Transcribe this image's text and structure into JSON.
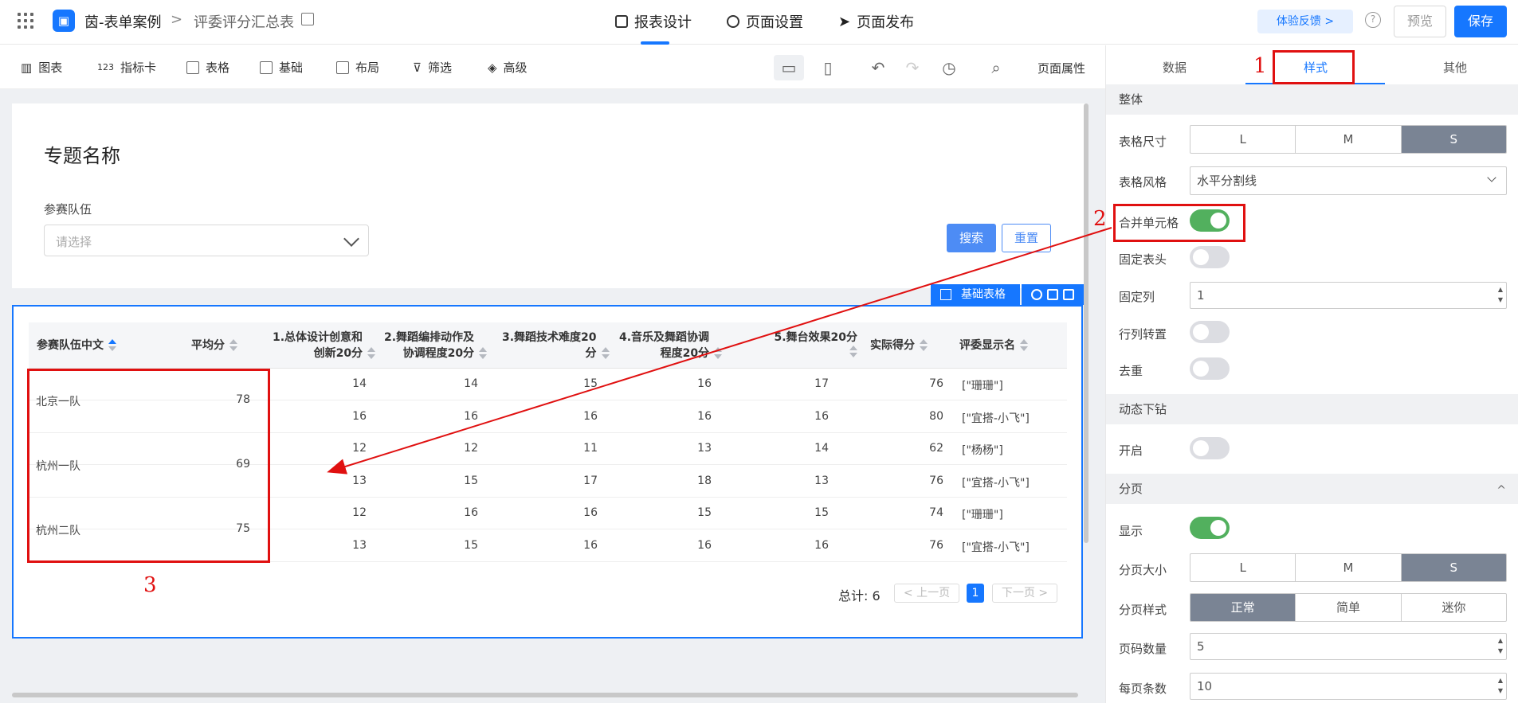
{
  "app": {
    "title": "茵-表单案例",
    "breadcrumb": "评委评分汇总表"
  },
  "top_tabs": [
    "报表设计",
    "页面设置",
    "页面发布"
  ],
  "feedback": "体验反馈 >",
  "help": "?",
  "preview": "预览",
  "save": "保存",
  "toolbar": {
    "items": [
      "图表",
      "指标卡",
      "表格",
      "基础",
      "布局",
      "筛选",
      "高级"
    ],
    "card_prefix": "123",
    "page_props": "页面属性"
  },
  "canvas": {
    "title": "专题名称",
    "filter_label": "参赛队伍",
    "filter_placeholder": "请选择",
    "search_btn": "搜索",
    "reset_btn": "重置",
    "table_tag": "基础表格"
  },
  "table": {
    "headers": [
      {
        "l1": "参赛队伍中文",
        "l2": ""
      },
      {
        "l1": "平均分",
        "l2": ""
      },
      {
        "l1": "1.总体设计创意和",
        "l2": "创新20分"
      },
      {
        "l1": "2.舞蹈编排动作及",
        "l2": "协调程度20分"
      },
      {
        "l1": "3.舞蹈技术难度20",
        "l2": "分"
      },
      {
        "l1": "4.音乐及舞蹈协调",
        "l2": "程度20分"
      },
      {
        "l1": "5.舞台效果20分",
        "l2": ""
      },
      {
        "l1": "实际得分",
        "l2": ""
      },
      {
        "l1": "评委显示名",
        "l2": ""
      }
    ],
    "merged": [
      {
        "team": "北京一队",
        "avg": "78"
      },
      {
        "team": "杭州一队",
        "avg": "69"
      },
      {
        "team": "杭州二队",
        "avg": "75"
      }
    ],
    "rows": [
      [
        "14",
        "14",
        "15",
        "16",
        "17",
        "76",
        "[\"珊珊\"]"
      ],
      [
        "16",
        "16",
        "16",
        "16",
        "16",
        "80",
        "[\"宜搭-小飞\"]"
      ],
      [
        "12",
        "12",
        "11",
        "13",
        "14",
        "62",
        "[\"杨杨\"]"
      ],
      [
        "13",
        "15",
        "17",
        "18",
        "13",
        "76",
        "[\"宜搭-小飞\"]"
      ],
      [
        "12",
        "16",
        "16",
        "15",
        "15",
        "74",
        "[\"珊珊\"]"
      ],
      [
        "13",
        "15",
        "16",
        "16",
        "16",
        "76",
        "[\"宜搭-小飞\"]"
      ]
    ],
    "pager": {
      "total": "总计: 6",
      "prev": "上一页",
      "page": "1",
      "next": "下一页"
    }
  },
  "panel": {
    "tabs": [
      "数据",
      "样式",
      "其他"
    ],
    "sec_overall": "整体",
    "table_size_label": "表格尺寸",
    "sizes": [
      "L",
      "M",
      "S"
    ],
    "table_style_label": "表格风格",
    "table_style_value": "水平分割线",
    "merge_label": "合并单元格",
    "fix_header_label": "固定表头",
    "fix_col_label": "固定列",
    "fix_col_value": "1",
    "transpose_label": "行列转置",
    "dedupe_label": "去重",
    "sec_drill": "动态下钻",
    "drill_on_label": "开启",
    "sec_paging": "分页",
    "paging_collapse": "^",
    "show_label": "显示",
    "page_size_label": "分页大小",
    "page_style_label": "分页样式",
    "page_styles": [
      "正常",
      "简单",
      "迷你"
    ],
    "page_count_label": "页码数量",
    "page_count_value": "5",
    "per_page_label": "每页条数",
    "per_page_value": "10"
  },
  "annotations": [
    "1",
    "2",
    "3"
  ],
  "colors": {
    "accent": "#1677ff",
    "annotation": "#e01010",
    "toggle_on": "#52b05e",
    "seg_selected": "#7a8494"
  }
}
